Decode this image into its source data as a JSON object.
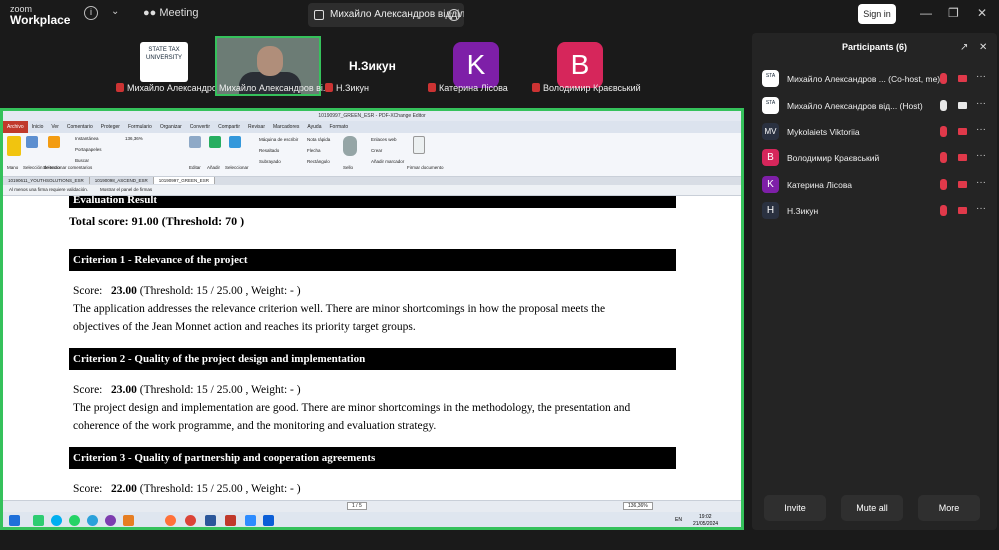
{
  "app": {
    "logo_small": "zoom",
    "logo_big": "Workplace",
    "meeting_label": "Meeting",
    "share_tab_title": "Михайло Александров відділ мі",
    "signin_label": "Sign in"
  },
  "tiles": [
    {
      "name": "Михайло Александро..."
    },
    {
      "name": "Михайло Александров ві..."
    },
    {
      "name": "Н.Зикун"
    },
    {
      "name": "Катерина Лісова",
      "initial": "K"
    },
    {
      "name": "Володимир Краєвський",
      "initial": "B"
    }
  ],
  "nz_label": "Н.Зикун",
  "sta_logo": "STATE TAX UNIVERSITY",
  "pdf": {
    "window_title": "10190997_GREEN_ESR - PDF-XChange Editor",
    "menu": [
      "Archivo",
      "Inicio",
      "Ver",
      "Comentario",
      "Proteger",
      "Formulario",
      "Organizar",
      "Convertir",
      "Compartir",
      "Revisar",
      "Marcadores",
      "Ayuda",
      "Formato"
    ],
    "ribbon": [
      "Mano",
      "Selección de texto",
      "Seleccionar comentarios",
      "Instantánea",
      "Portapapeles",
      "Buscar",
      "Editar",
      "Añadir",
      "Seleccionar",
      "Máquina de escribir",
      "Resaltado",
      "Subrayado",
      "Nota rápida",
      "Flecha",
      "Rectángulo",
      "Sello",
      "Enlaces web",
      "Crear",
      "Añadir marcador",
      "Firmar documento"
    ],
    "tabs": [
      "10190611_YOUTHSOLUTIONS_ESR",
      "10190098_ASCEND_ESR",
      "10190997_GREEN_ESR"
    ],
    "notice": [
      "Al menos una firma requiere validación.",
      "Mostrar el panel de firmas"
    ],
    "zoom": "136,36%",
    "page_box": "1 / 5"
  },
  "doc": {
    "header": "Evaluation Result",
    "total": "Total score: 91.00 (Threshold: 70 )",
    "criteria": [
      {
        "title": "Criterion 1 - Relevance of the project",
        "score_label": "Score:",
        "score": "23.00",
        "threshold": "(Threshold: 15 / 25.00 , Weight: - )",
        "text1": "The application addresses the relevance criterion well. There are minor shortcomings in how the proposal meets the",
        "text2": "objectives of the Jean Monnet action and reaches its priority target groups."
      },
      {
        "title": "Criterion 2 - Quality of the project design and implementation",
        "score_label": "Score:",
        "score": "23.00",
        "threshold": "(Threshold: 15 / 25.00 , Weight: - )",
        "text1": "The project design and implementation are good. There are minor shortcomings in the methodology, the presentation and",
        "text2": "coherence of the work programme, and the monitoring and evaluation strategy."
      },
      {
        "title": "Criterion 3 - Quality of partnership and cooperation agreements",
        "score_label": "Score:",
        "score": "22.00",
        "threshold": "(Threshold: 15 / 25.00 , Weight: - )"
      }
    ]
  },
  "taskbar": {
    "clock": "19:02",
    "date": "21/05/2024",
    "lang": "EN"
  },
  "panel": {
    "title": "Participants (6)",
    "participants": [
      {
        "name": "Михайло Александров ... (Co-host, me)",
        "initial": "",
        "color": "#ffffff",
        "mic": "muted",
        "cam": "off"
      },
      {
        "name": "Михайло Александров від... (Host)",
        "initial": "",
        "color": "#ffffff",
        "mic": "on",
        "cam": "on"
      },
      {
        "name": "Mykolaiets Viktoriia",
        "initial": "MV",
        "color": "#2a3140",
        "mic": "muted",
        "cam": "off"
      },
      {
        "name": "Володимир Краєвський",
        "initial": "B",
        "color": "#d6265b",
        "mic": "muted",
        "cam": "off"
      },
      {
        "name": "Катерина Лісова",
        "initial": "K",
        "color": "#7e1fa8",
        "mic": "muted",
        "cam": "off"
      },
      {
        "name": "Н.Зикун",
        "initial": "H",
        "color": "#2a3140",
        "mic": "muted",
        "cam": "off"
      }
    ],
    "buttons": {
      "invite": "Invite",
      "mute_all": "Mute all",
      "more": "More"
    }
  }
}
